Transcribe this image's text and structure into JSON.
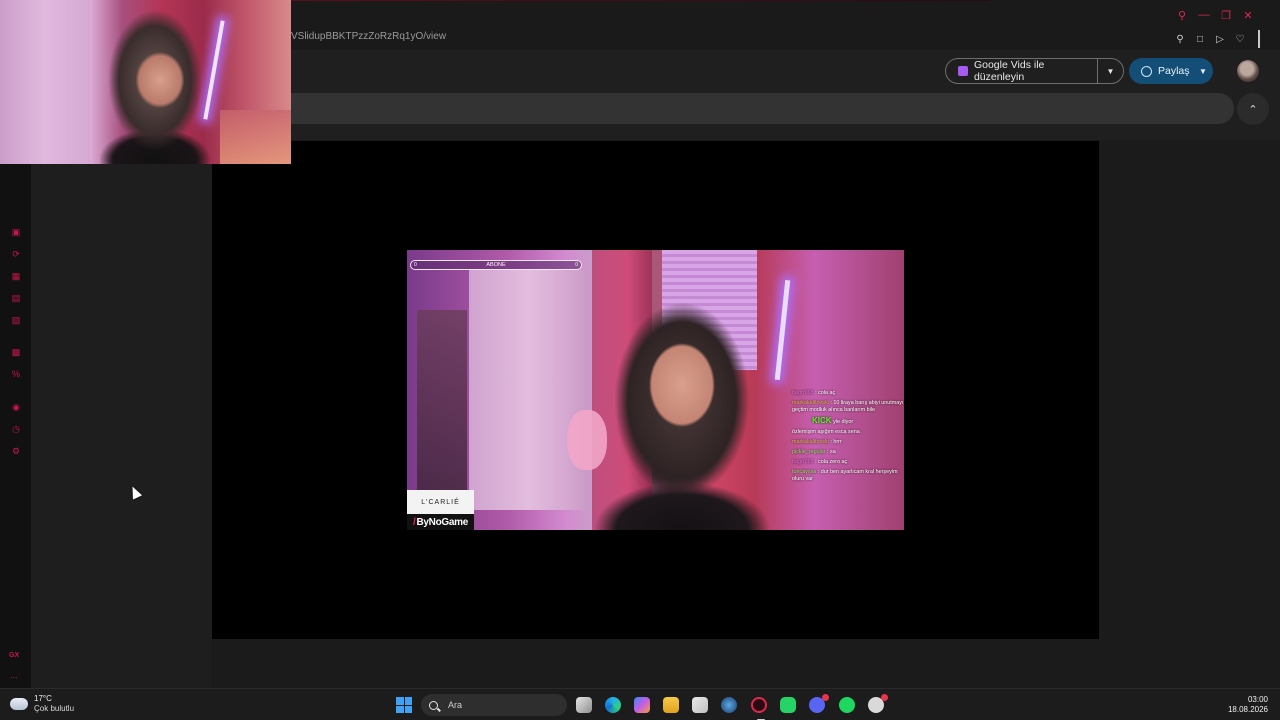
{
  "browser": {
    "url": "VSlidupBBKTPzzZoRzRq1yO/view",
    "window_controls": [
      "search-icon",
      "minimize-icon",
      "restore-icon",
      "close-icon"
    ],
    "toolbar_icons": [
      "pin-icon",
      "screenshot-icon",
      "play-icon",
      "heart-icon"
    ]
  },
  "drive": {
    "vids_button": "Google Vids ile düzenleyin",
    "share_button": "Paylaş"
  },
  "video": {
    "abone_label": "ABONE",
    "abone_left": "0",
    "abone_right": "0",
    "brand_top": "L'CARLIÉ",
    "brand_bottom": "ByNoGame",
    "chat": [
      {
        "user": "bagrr965",
        "text": " : cola aç"
      },
      {
        "user": "markakalitovski",
        "text": " : 10 liraya barış abiyi unutmayı geçtim modluk alınca banlarım bile"
      },
      {
        "user": "",
        "text": "yle diyor"
      },
      {
        "user": "",
        "text": "özlemişim aşığım esca sena"
      },
      {
        "user": "markakalitovski",
        "text": " : hrrr"
      },
      {
        "user": "pickle_regular",
        "text": " : sa"
      },
      {
        "user": "bagrr965",
        "text": " : cola zero aç"
      },
      {
        "user": "tuncayssa",
        "text": " : dur ben ayarlıcam kral herşeyim oluru var"
      }
    ],
    "kick_label": "KICK"
  },
  "sidebar": {
    "gx_label": "GX",
    "more_label": "..."
  },
  "taskbar": {
    "weather_temp": "17°C",
    "weather_cond": "Çok bulutlu",
    "search_label": "Ara",
    "time": "03:00",
    "date": "18.08.2026"
  }
}
